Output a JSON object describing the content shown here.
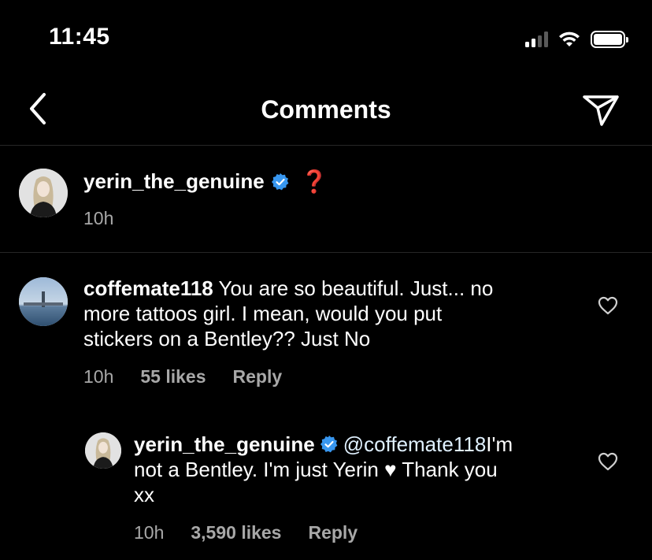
{
  "status_bar": {
    "time": "11:45"
  },
  "header": {
    "title": "Comments"
  },
  "caption": {
    "username": "yerin_the_genuine",
    "emoji": "❓",
    "time": "10h"
  },
  "comments": [
    {
      "username": "coffemate118",
      "text_line1": " You are so beautiful. Just... no",
      "text_line2": "more tattoos girl. I mean, would you put",
      "text_line3": "stickers on a Bentley?? Just No",
      "time": "10h",
      "likes": "55 likes",
      "reply_label": "Reply"
    }
  ],
  "reply": {
    "username": "yerin_the_genuine",
    "mention": "@coffemate118",
    "text_line1_rest": " I'm",
    "text_line2_a": "not a Bentley. I'm just Yerin ",
    "heart_emoji": "♥",
    "text_line2_b": " Thank you",
    "text_line3": "xx",
    "time": "10h",
    "likes": "3,590 likes",
    "reply_label": "Reply"
  },
  "colors": {
    "background": "#000000",
    "muted_text": "#a8a8a8",
    "verified_blue": "#3897f0",
    "mention_blue": "#e0f1ff",
    "divider": "#262626"
  }
}
